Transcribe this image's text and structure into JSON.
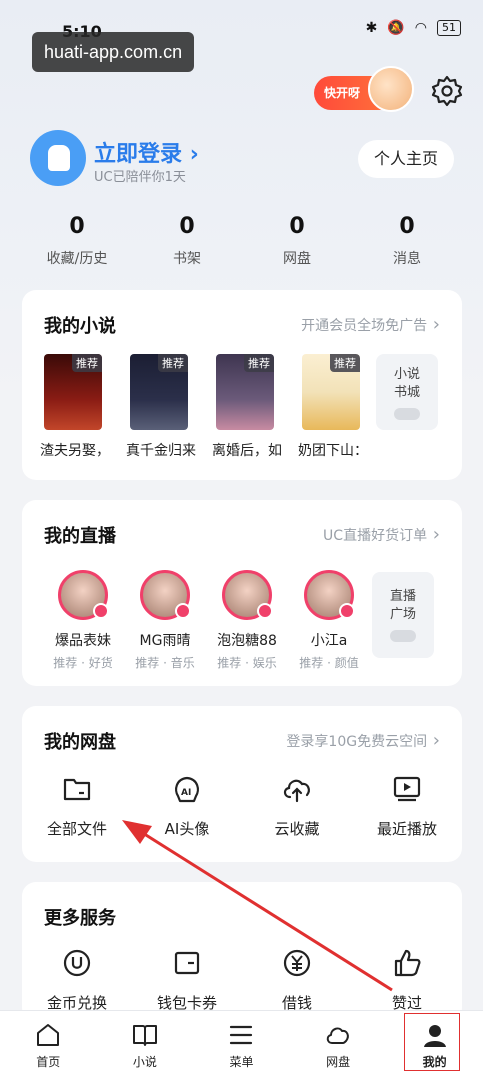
{
  "status": {
    "time": "5:10",
    "battery": "51"
  },
  "watermark": "huati-app.com.cn",
  "promo": {
    "label": "快开呀"
  },
  "profile": {
    "login": "立即登录",
    "login_chevron": "›",
    "subtitle": "UC已陪伴你1天",
    "homepage_button": "个人主页"
  },
  "stats": [
    {
      "value": "0",
      "label": "收藏/历史"
    },
    {
      "value": "0",
      "label": "书架"
    },
    {
      "value": "0",
      "label": "网盘"
    },
    {
      "value": "0",
      "label": "消息"
    }
  ],
  "novels": {
    "title": "我的小说",
    "link": "开通会员全场免广告",
    "tag": "推荐",
    "items": [
      {
        "name": "渣夫另娶，",
        "color": "#8a1c14"
      },
      {
        "name": "真千金归来",
        "color": "#2b2f4a"
      },
      {
        "name": "离婚后，如",
        "color": "#6b5a7a"
      },
      {
        "name": "奶团下山：",
        "color": "#f2e2b8"
      }
    ],
    "side_line1": "小说",
    "side_line2": "书城"
  },
  "live": {
    "title": "我的直播",
    "link": "UC直播好货订单",
    "items": [
      {
        "name": "爆品表妹",
        "tags": "推荐 · 好货"
      },
      {
        "name": "MG雨晴",
        "tags": "推荐 · 音乐"
      },
      {
        "name": "泡泡糖88",
        "tags": "推荐 · 娱乐"
      },
      {
        "name": "小江a",
        "tags": "推荐 · 颜值"
      }
    ],
    "side_line1": "直播",
    "side_line2": "广场"
  },
  "cloud": {
    "title": "我的网盘",
    "link": "登录享10G免费云空间",
    "items": [
      {
        "label": "全部文件",
        "icon": "folder-icon"
      },
      {
        "label": "AI头像",
        "icon": "ai-avatar-icon"
      },
      {
        "label": "云收藏",
        "icon": "cloud-upload-icon"
      },
      {
        "label": "最近播放",
        "icon": "play-icon"
      }
    ]
  },
  "services": {
    "title": "更多服务",
    "items": [
      {
        "label": "金币兑换",
        "icon": "coin-icon"
      },
      {
        "label": "钱包卡券",
        "icon": "wallet-icon"
      },
      {
        "label": "借钱",
        "icon": "yuan-icon"
      },
      {
        "label": "赞过",
        "icon": "thumbs-up-icon"
      }
    ]
  },
  "tabs": [
    {
      "label": "首页",
      "icon": "home-icon"
    },
    {
      "label": "小说",
      "icon": "book-icon"
    },
    {
      "label": "菜单",
      "icon": "menu-icon"
    },
    {
      "label": "网盘",
      "icon": "cloud-icon"
    },
    {
      "label": "我的",
      "icon": "profile-icon",
      "active": true
    }
  ],
  "annotation_color": "#e03030",
  "accent": "#2a7cea"
}
